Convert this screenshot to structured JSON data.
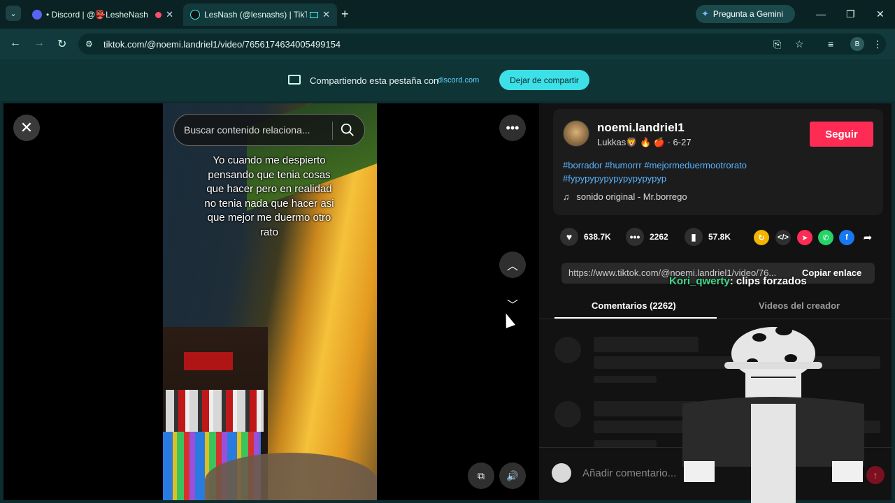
{
  "browser": {
    "tabs": [
      {
        "title": "• Discord | @👺LesheNash",
        "favicon": "discord-icon"
      },
      {
        "title": "LesNash (@lesnashs) | TikTok",
        "favicon": "tiktok-icon"
      }
    ],
    "new_tab": "+",
    "gemini_label": "Pregunta a Gemini",
    "url": "tiktok.com/@noemi.landriel1/video/7656174634005499154",
    "profile_initial": "B"
  },
  "share_bar": {
    "text": "Compartiendo esta pestaña con",
    "domain": "discord.com",
    "stop_label": "Dejar de compartir"
  },
  "video": {
    "search_placeholder": "Buscar contenido relaciona...",
    "caption": "Yo cuando me despierto pensando que tenia cosas que hacer pero en realidad no tenia nada que hacer asi que mejor me duermo otro rato"
  },
  "author": {
    "username": "noemi.landriel1",
    "subtitle": "Lukkas🦁 🔥 🍎 · 6-27",
    "follow_label": "Seguir"
  },
  "post": {
    "hashtags": "#borrador #humorrr #mejormeduermootrorato #fypypypypypypypypypyp",
    "sound": "sonido original - Mr.borrego"
  },
  "stats": {
    "likes": "638.7K",
    "comments": "2262",
    "saves": "57.8K"
  },
  "link": {
    "url": "https://www.tiktok.com/@noemi.landriel1/video/76...",
    "copy_label": "Copiar enlace"
  },
  "overlay_chat": {
    "user": "Kori_qwerty",
    "message": ": clips forzados"
  },
  "tabs": {
    "comments": "Comentarios (2262)",
    "creator": "Videos del creador"
  },
  "comment_input": {
    "placeholder": "Añadir comentario..."
  },
  "colors": {
    "follow": "#fe2c55",
    "share_button": "#3ee0e8",
    "hashtag": "#57b4ff"
  }
}
